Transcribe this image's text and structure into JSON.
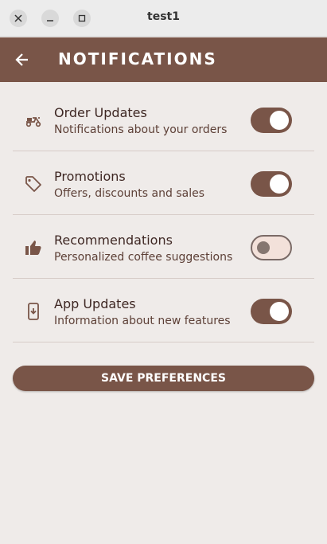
{
  "window": {
    "title": "test1",
    "controls": [
      "close-icon",
      "minimize-icon",
      "maximize-icon"
    ]
  },
  "appbar": {
    "title": "NOTIFICATIONS",
    "back_icon": "arrow-back-icon",
    "color": "#795548"
  },
  "settings": [
    {
      "title": "Order Updates",
      "subtitle": "Notifications about your orders",
      "icon": "delivery-scooter-icon",
      "enabled": true
    },
    {
      "title": "Promotions",
      "subtitle": "Offers, discounts and sales",
      "icon": "tag-icon",
      "enabled": true
    },
    {
      "title": "Recommendations",
      "subtitle": "Personalized coffee suggestions",
      "icon": "thumb-up-icon",
      "enabled": false
    },
    {
      "title": "App Updates",
      "subtitle": "Information about new features",
      "icon": "phone-download-icon",
      "enabled": true
    }
  ],
  "save_button": {
    "label": "SAVE PREFERENCES"
  },
  "colors": {
    "background": "#efebe9",
    "accent": "#795548",
    "divider": "#d7ccc8"
  }
}
